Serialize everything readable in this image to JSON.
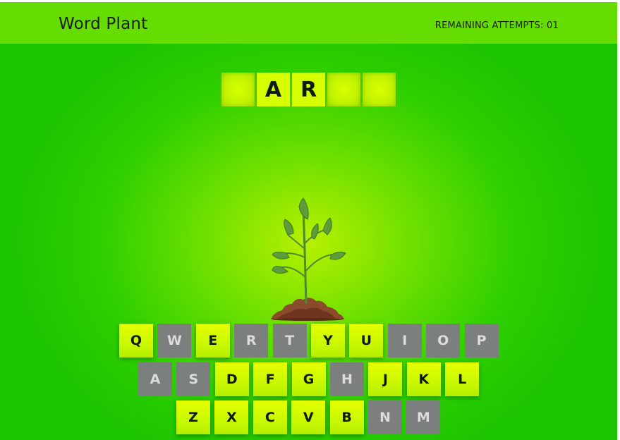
{
  "app": {
    "title": "Word Plant",
    "remaining_attempts_label": "REMAINING ATTEMPTS: 01"
  },
  "word": {
    "slots": [
      "",
      "A",
      "R",
      "",
      ""
    ]
  },
  "keyboard": {
    "rows": [
      [
        {
          "letter": "Q",
          "state": "available"
        },
        {
          "letter": "W",
          "state": "used"
        },
        {
          "letter": "E",
          "state": "available"
        },
        {
          "letter": "R",
          "state": "used"
        },
        {
          "letter": "T",
          "state": "used"
        },
        {
          "letter": "Y",
          "state": "available"
        },
        {
          "letter": "U",
          "state": "available"
        },
        {
          "letter": "I",
          "state": "used"
        },
        {
          "letter": "O",
          "state": "used"
        },
        {
          "letter": "P",
          "state": "used"
        }
      ],
      [
        {
          "letter": "A",
          "state": "used"
        },
        {
          "letter": "S",
          "state": "used"
        },
        {
          "letter": "D",
          "state": "available"
        },
        {
          "letter": "F",
          "state": "available"
        },
        {
          "letter": "G",
          "state": "available"
        },
        {
          "letter": "H",
          "state": "used"
        },
        {
          "letter": "J",
          "state": "available"
        },
        {
          "letter": "K",
          "state": "available"
        },
        {
          "letter": "L",
          "state": "available"
        }
      ],
      [
        {
          "letter": "Z",
          "state": "available"
        },
        {
          "letter": "X",
          "state": "available"
        },
        {
          "letter": "C",
          "state": "available"
        },
        {
          "letter": "V",
          "state": "available"
        },
        {
          "letter": "B",
          "state": "available"
        },
        {
          "letter": "N",
          "state": "used"
        },
        {
          "letter": "M",
          "state": "used"
        }
      ]
    ]
  },
  "colors": {
    "key_available": "#d6ff00",
    "key_used": "#7b7f7d",
    "header": "#66dd00",
    "background_center": "#b8f000",
    "background_edge": "#1cc400"
  },
  "illustration": {
    "icon": "sprout-plant-icon"
  }
}
